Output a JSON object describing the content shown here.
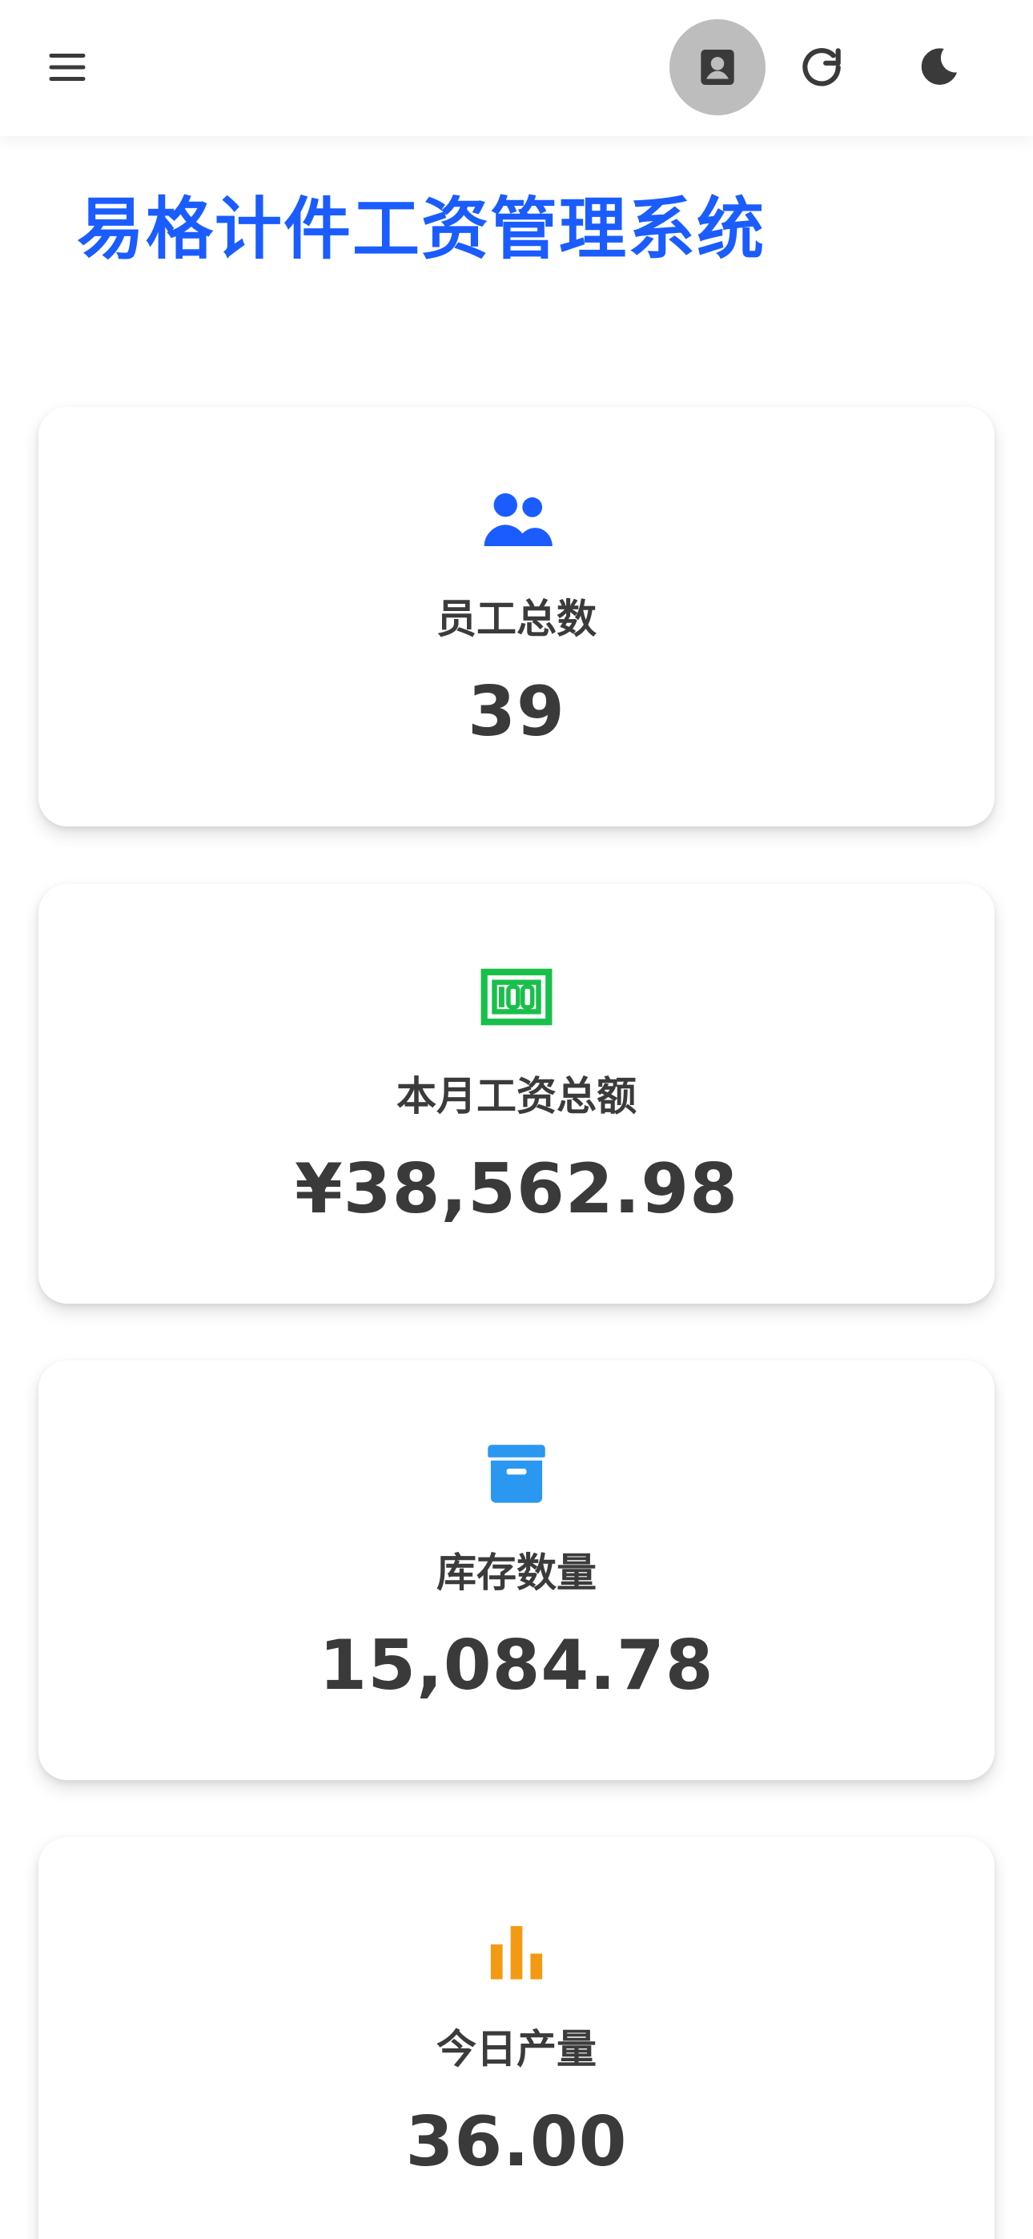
{
  "colors": {
    "title": "#1a5cff",
    "employees_icon": "#1a5cff",
    "salary_icon": "#18c04a",
    "inventory_icon": "#2a97f0",
    "output_icon": "#f49a12",
    "avatar_bg": "#bdbdbd",
    "text": "#3a3a3a"
  },
  "topbar": {
    "menu_icon": "menu-icon",
    "profile_icon": "profile-icon",
    "refresh_icon": "refresh-icon",
    "theme_icon": "moon-icon"
  },
  "page": {
    "title": "易格计件工资管理系统"
  },
  "cards": [
    {
      "icon": "users-icon",
      "label": "员工总数",
      "value": "39"
    },
    {
      "icon": "money-icon",
      "label": "本月工资总额",
      "value": "¥38,562.98"
    },
    {
      "icon": "inventory-box-icon",
      "label": "库存数量",
      "value": "15,084.78"
    },
    {
      "icon": "bar-chart-icon",
      "label": "今日产量",
      "value": "36.00"
    }
  ]
}
